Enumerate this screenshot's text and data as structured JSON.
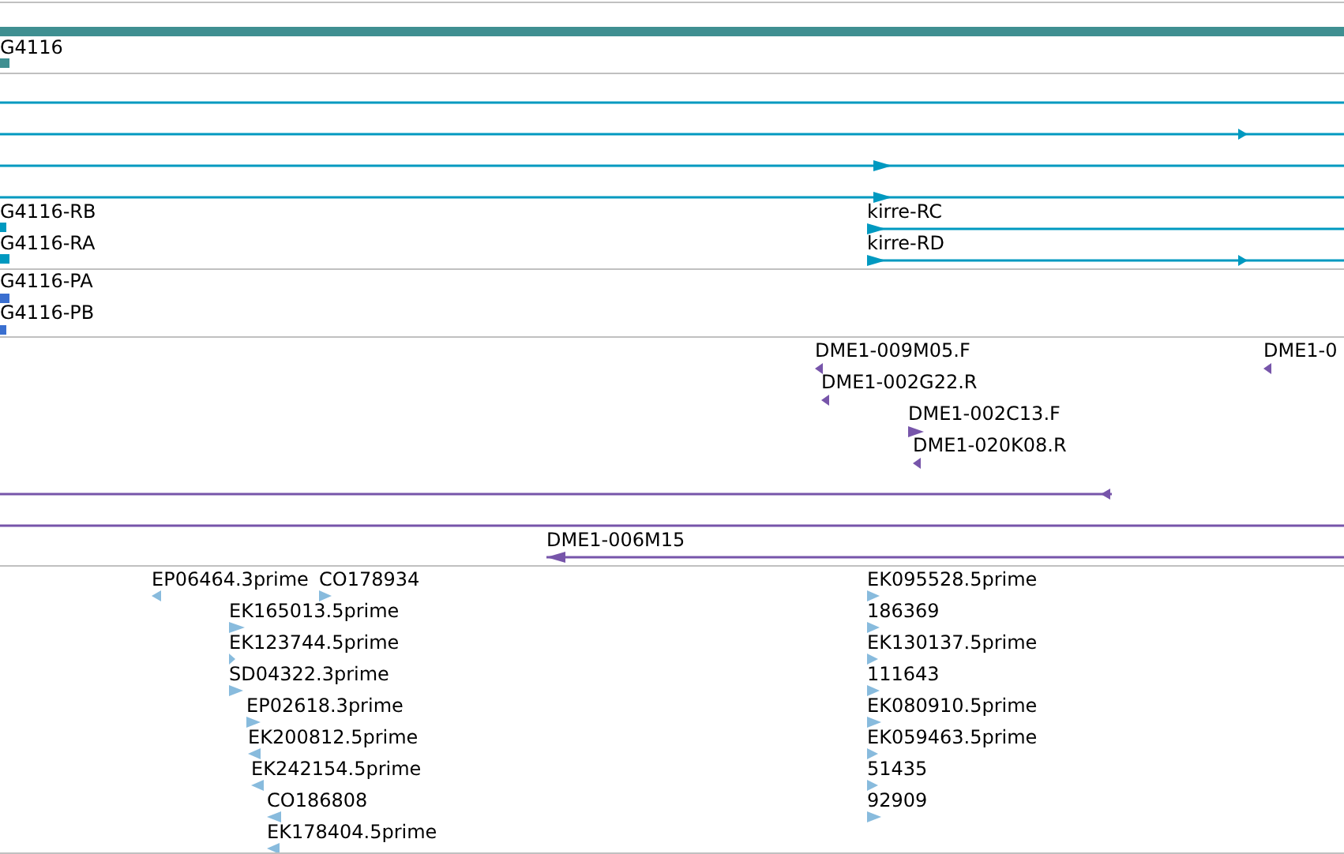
{
  "tracks": [
    {
      "kind": "gene",
      "features": [
        {
          "kind": "bar"
        },
        {
          "kind": "block",
          "label": "G4116"
        }
      ]
    },
    {
      "kind": "transcript",
      "features": [
        {
          "kind": "line"
        },
        {
          "kind": "line",
          "reverse": false
        },
        {
          "kind": "line",
          "reverse": false
        },
        {
          "kind": "line",
          "reverse": false
        },
        {
          "kind": "block",
          "label": "G4116-RB"
        },
        {
          "kind": "line",
          "label": "kirre-RC",
          "reverse": false
        },
        {
          "kind": "block",
          "label": "G4116-RA"
        },
        {
          "kind": "line",
          "label": "kirre-RD",
          "reverse": false
        }
      ]
    },
    {
      "kind": "protein",
      "features": [
        {
          "kind": "block",
          "label": "G4116-PA"
        },
        {
          "kind": "block",
          "label": "G4116-PB"
        }
      ]
    },
    {
      "kind": "clone",
      "features": [
        {
          "kind": "arrow",
          "label": "DME1-009M05.F",
          "reverse": true
        },
        {
          "kind": "arrow",
          "label": "DME1-002G22.R",
          "reverse": true
        },
        {
          "kind": "arrow",
          "label": "DME1-0",
          "reverse": true
        },
        {
          "kind": "arrow",
          "label": "DME1-002C13.F",
          "reverse": false
        },
        {
          "kind": "arrow",
          "label": "DME1-020K08.R",
          "reverse": true
        },
        {
          "kind": "line",
          "reverse": true
        },
        {
          "kind": "line"
        },
        {
          "kind": "line",
          "label": "DME1-006M15",
          "reverse": true
        }
      ]
    },
    {
      "kind": "est",
      "features": [
        {
          "kind": "arrow",
          "label": "EP06464.3prime",
          "reverse": true
        },
        {
          "kind": "arrow",
          "label": "CO178934",
          "reverse": false
        },
        {
          "kind": "arrow",
          "label": "EK165013.5prime",
          "reverse": false
        },
        {
          "kind": "arrow",
          "label": "EK123744.5prime",
          "reverse": false
        },
        {
          "kind": "arrow",
          "label": "SD04322.3prime",
          "reverse": false
        },
        {
          "kind": "arrow",
          "label": "EP02618.3prime",
          "reverse": false
        },
        {
          "kind": "arrow",
          "label": "EK200812.5prime",
          "reverse": true
        },
        {
          "kind": "arrow",
          "label": "EK242154.5prime",
          "reverse": true
        },
        {
          "kind": "arrow",
          "label": "CO186808",
          "reverse": true
        },
        {
          "kind": "arrow",
          "label": "EK178404.5prime",
          "reverse": true
        },
        {
          "kind": "arrow",
          "label": "EK095528.5prime",
          "reverse": false
        },
        {
          "kind": "arrow",
          "label": "186369",
          "reverse": false
        },
        {
          "kind": "arrow",
          "label": "EK130137.5prime",
          "reverse": false
        },
        {
          "kind": "arrow",
          "label": "111643",
          "reverse": false
        },
        {
          "kind": "arrow",
          "label": "EK080910.5prime",
          "reverse": false
        },
        {
          "kind": "arrow",
          "label": "EK059463.5prime",
          "reverse": false
        },
        {
          "kind": "arrow",
          "label": "51435",
          "reverse": false
        },
        {
          "kind": "arrow",
          "label": "92909",
          "reverse": false
        }
      ]
    }
  ]
}
